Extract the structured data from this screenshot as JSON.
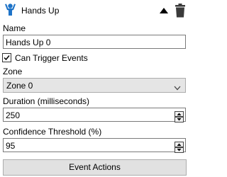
{
  "header": {
    "title": "Hands Up",
    "icon": "person-hands-up-icon",
    "icon_color": "#1e73c8",
    "collapse_icon": "triangle-up-icon",
    "delete_icon": "trash-icon"
  },
  "fields": {
    "name": {
      "label": "Name",
      "value": "Hands Up 0"
    },
    "can_trigger": {
      "label": "Can Trigger Events",
      "checked": true
    },
    "zone": {
      "label": "Zone",
      "value": "Zone 0"
    },
    "duration": {
      "label": "Duration (milliseconds)",
      "value": "250"
    },
    "confidence": {
      "label": "Confidence Threshold (%)",
      "value": "95"
    }
  },
  "actions": {
    "event_actions_label": "Event Actions"
  }
}
